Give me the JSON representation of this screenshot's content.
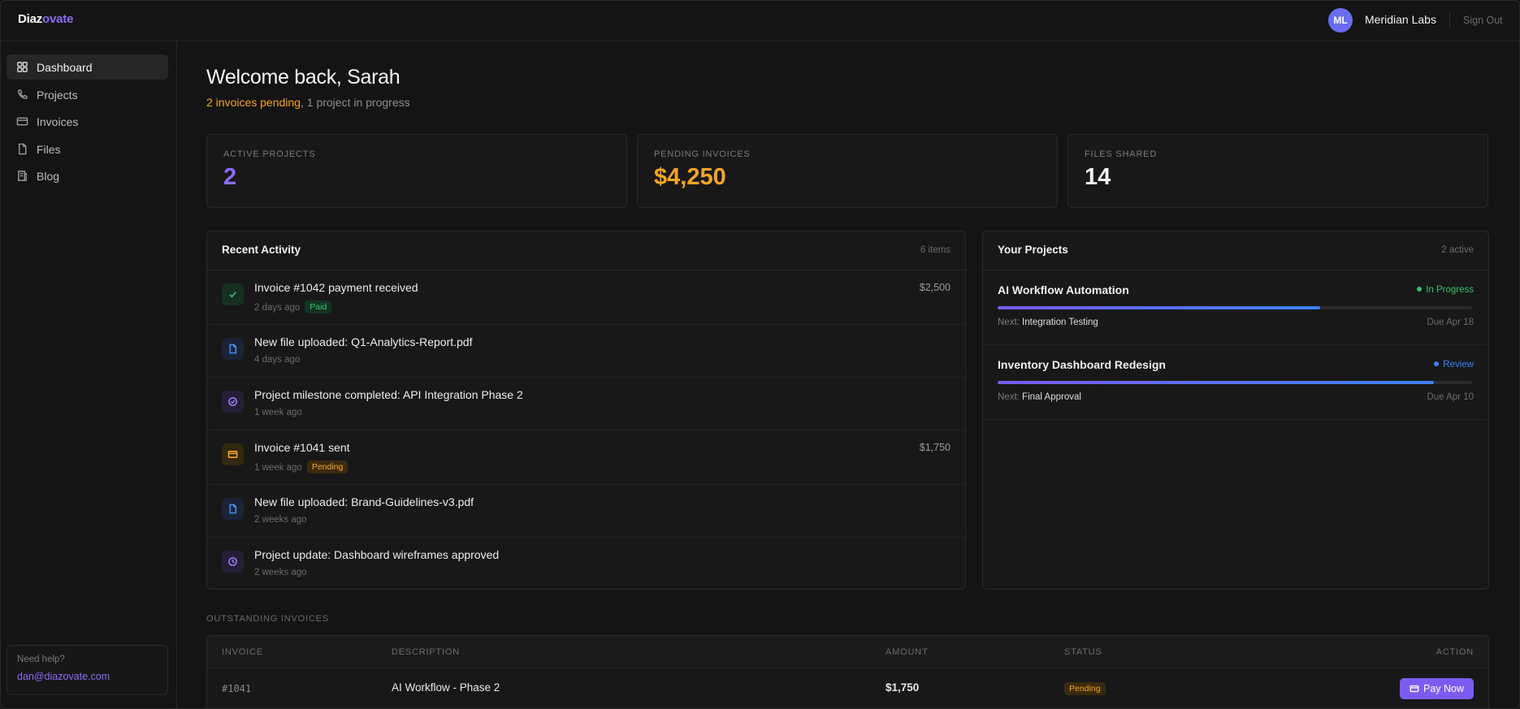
{
  "header": {
    "logo_prefix": "Diaz",
    "logo_accent": "ovate",
    "avatar_initials": "ML",
    "org_name": "Meridian Labs",
    "sign_out": "Sign Out"
  },
  "sidebar": {
    "items": [
      {
        "label": "Dashboard",
        "icon": "grid-icon",
        "active": true
      },
      {
        "label": "Projects",
        "icon": "phone-icon",
        "active": false
      },
      {
        "label": "Invoices",
        "icon": "card-icon",
        "active": false
      },
      {
        "label": "Files",
        "icon": "file-icon",
        "active": false
      },
      {
        "label": "Blog",
        "icon": "blog-icon",
        "active": false
      }
    ],
    "help": {
      "title": "Need help?",
      "email": "dan@diazovate.com"
    }
  },
  "main": {
    "welcome": "Welcome back, Sarah",
    "subline_warn": "2 invoices pending",
    "subline_rest": ", 1 project in progress",
    "stats": [
      {
        "label": "ACTIVE PROJECTS",
        "value": "2",
        "color": "#8b6cf6"
      },
      {
        "label": "PENDING INVOICES",
        "value": "$4,250",
        "color": "#f5a524"
      },
      {
        "label": "FILES SHARED",
        "value": "14",
        "color": "#f2f2f2"
      }
    ],
    "activity": {
      "title": "Recent Activity",
      "meta": "6 items",
      "items": [
        {
          "title": "Invoice #1042 payment received",
          "time": "2 days ago",
          "badge": "Paid",
          "amount": "$2,500",
          "icon": "check-icon"
        },
        {
          "title": "New file uploaded: Q1-Analytics-Report.pdf",
          "time": "4 days ago",
          "icon": "file-icon"
        },
        {
          "title": "Project milestone completed: API Integration Phase 2",
          "time": "1 week ago",
          "icon": "check-circle-icon"
        },
        {
          "title": "Invoice #1041 sent",
          "time": "1 week ago",
          "badge": "Pending",
          "amount": "$1,750",
          "icon": "card-icon"
        },
        {
          "title": "New file uploaded: Brand-Guidelines-v3.pdf",
          "time": "2 weeks ago",
          "icon": "file-icon"
        },
        {
          "title": "Project update: Dashboard wireframes approved",
          "time": "2 weeks ago",
          "icon": "clock-icon"
        }
      ]
    },
    "projects": {
      "title": "Your Projects",
      "meta": "2 active",
      "items": [
        {
          "name": "AI Workflow Automation",
          "status": "In Progress",
          "status_color": "#37c271",
          "progress": 0.68,
          "next_label": "Next: ",
          "next": "Integration Testing",
          "due": "Due Apr 18"
        },
        {
          "name": "Inventory Dashboard Redesign",
          "status": "Review",
          "status_color": "#3b82f6",
          "progress": 0.92,
          "next_label": "Next: ",
          "next": "Final Approval",
          "due": "Due Apr 10"
        }
      ]
    },
    "outstanding": {
      "label": "OUTSTANDING INVOICES",
      "columns": [
        "INVOICE",
        "DESCRIPTION",
        "AMOUNT",
        "STATUS",
        "ACTION"
      ],
      "rows": [
        {
          "invoice": "#1041",
          "description": "AI Workflow - Phase 2",
          "amount": "$1,750",
          "status": "Pending",
          "action": "Pay Now"
        }
      ]
    }
  }
}
